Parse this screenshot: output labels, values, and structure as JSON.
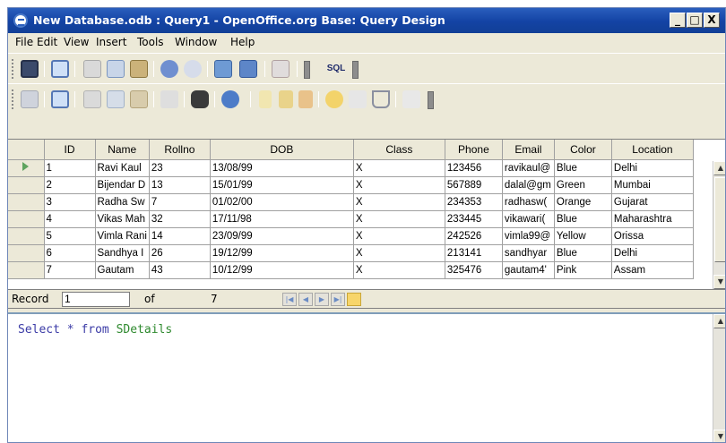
{
  "window": {
    "title": "New Database.odb : Query1 - OpenOffice.org Base: Query Design",
    "controls": [
      "_",
      "□",
      "X"
    ]
  },
  "menu": [
    "File",
    "Edit",
    "View",
    "Insert",
    "Tools",
    "Window",
    "Help"
  ],
  "toolbar1": {
    "icons": [
      "save-icon",
      "edit-icon",
      "cut-icon",
      "copy-icon",
      "paste-icon",
      "undo-icon",
      "redo-icon",
      "add-tables-icon",
      "design-view-icon",
      "delete-icon",
      "run-sql-icon"
    ],
    "sql_label": "SQL"
  },
  "toolbar2": {
    "icons": [
      "save-record-icon",
      "edit-data-icon",
      "cut-icon",
      "copy-icon",
      "paste-icon",
      "undo-icon",
      "find-icon",
      "refresh-icon",
      "sort-ascending-icon",
      "sort-az-icon",
      "sort-za-icon",
      "autofilter-icon",
      "standard-filter-icon",
      "filter-icon",
      "remove-filter-icon"
    ]
  },
  "grid": {
    "columns": [
      "ID",
      "Name",
      "Rollno",
      "DOB",
      "Class",
      "Phone",
      "Email",
      "Color",
      "Location"
    ],
    "rows": [
      [
        "1",
        "Ravi Kaul",
        "23",
        "13/08/99",
        "X",
        "123456",
        "ravikaul@",
        "Blue",
        "Delhi"
      ],
      [
        "2",
        "Bijendar D",
        "13",
        "15/01/99",
        "X",
        "567889",
        "dalal@gm",
        "Green",
        "Mumbai"
      ],
      [
        "3",
        "Radha Sw",
        "7",
        "01/02/00",
        "X",
        "234353",
        "radhasw(",
        "Orange",
        "Gujarat"
      ],
      [
        "4",
        "Vikas Mah",
        "32",
        "17/11/98",
        "X",
        "233445",
        "vikawari(",
        "Blue",
        "Maharashtra"
      ],
      [
        "5",
        "Vimla Rani",
        "14",
        "23/09/99",
        "X",
        "242526",
        "vimla99@",
        "Yellow",
        "Orissa"
      ],
      [
        "6",
        "Sandhya I",
        "26",
        "19/12/99",
        "X",
        "213141",
        "sandhyar",
        "Blue",
        "Delhi"
      ],
      [
        "7",
        "Gautam",
        "43",
        "10/12/99",
        "X",
        "325476",
        "gautam4'",
        "Pink",
        "Assam"
      ]
    ]
  },
  "record_nav": {
    "label": "Record",
    "current": "1",
    "of_label": "of",
    "total": "7"
  },
  "sql": {
    "keyword1": "Select",
    "star": "*",
    "keyword2": "from",
    "table": "SDetails"
  },
  "colors": {
    "title_bar": "#1343a4",
    "window_bg": "#ece9d8",
    "sql_keyword": "#3a3aa6",
    "sql_identifier": "#2f8a2f"
  }
}
